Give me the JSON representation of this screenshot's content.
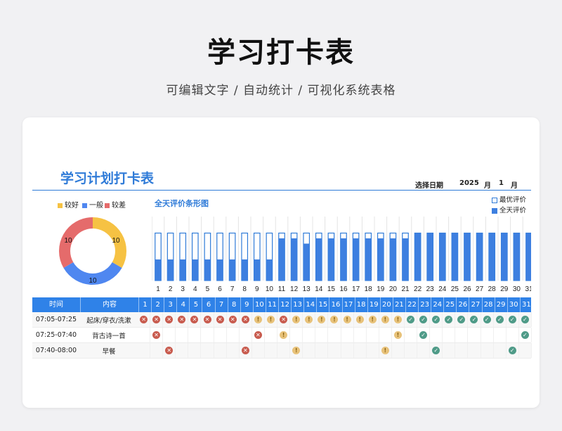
{
  "hero": {
    "title": "学习打卡表",
    "subtitle": "可编辑文字 / 自动统计 / 可视化系统表格"
  },
  "sheet": {
    "title": "学习计划打卡表",
    "date_label": "选择日期",
    "year": "2025",
    "year_unit": "月",
    "month": "1",
    "month_unit": "月"
  },
  "summary_legend": [
    {
      "label": "较好",
      "color": "#f6c243"
    },
    {
      "label": "一般",
      "color": "#4f87f0"
    },
    {
      "label": "较差",
      "color": "#e56b6b"
    }
  ],
  "summary_counts": [
    10,
    10,
    10
  ],
  "chart_title": "全天评价条形图",
  "chart_legend": {
    "best": "最优评价",
    "all": "全天评价"
  },
  "table": {
    "header_time": "时间",
    "header_content": "内容",
    "rows": [
      {
        "time": "07:05-07:25",
        "content": "起床/穿衣/洗漱",
        "marks": [
          "bad",
          "bad",
          "bad",
          "bad",
          "bad",
          "bad",
          "bad",
          "bad",
          "bad",
          "ok",
          "ok",
          "bad",
          "ok",
          "ok",
          "ok",
          "ok",
          "ok",
          "ok",
          "ok",
          "ok",
          "ok",
          "good",
          "good",
          "good",
          "good",
          "good",
          "good",
          "good",
          "good",
          "good",
          "good"
        ]
      },
      {
        "time": "07:25-07:40",
        "content": "背古诗一首",
        "marks": [
          "",
          "bad",
          "",
          "",
          "",
          "",
          "",
          "",
          "",
          "bad",
          "",
          "ok",
          "",
          "",
          "",
          "",
          "",
          "",
          "",
          "",
          "ok",
          "",
          "good",
          "",
          "",
          "",
          "",
          "",
          "",
          "",
          "good"
        ]
      },
      {
        "time": "07:40-08:00",
        "content": "早餐",
        "marks": [
          "",
          "",
          "bad",
          "",
          "",
          "",
          "",
          "",
          "bad",
          "",
          "",
          "",
          "ok",
          "",
          "",
          "",
          "",
          "",
          "",
          "ok",
          "",
          "",
          "",
          "good",
          "",
          "",
          "",
          "",
          "",
          "good",
          ""
        ]
      }
    ]
  },
  "chart_data": {
    "type": "bar",
    "title": "全天评价条形图",
    "categories": [
      "1",
      "2",
      "3",
      "4",
      "5",
      "6",
      "7",
      "8",
      "9",
      "10",
      "11",
      "12",
      "13",
      "14",
      "15",
      "16",
      "17",
      "18",
      "19",
      "20",
      "21",
      "22",
      "23",
      "24",
      "25",
      "26",
      "27",
      "28",
      "29",
      "30",
      "31"
    ],
    "series": [
      {
        "name": "最优评价",
        "values": [
          9,
          9,
          9,
          9,
          9,
          9,
          9,
          9,
          9,
          9,
          9,
          9,
          9,
          9,
          9,
          9,
          9,
          9,
          9,
          9,
          9,
          9,
          9,
          9,
          9,
          9,
          9,
          9,
          9,
          9,
          9
        ]
      },
      {
        "name": "全天评价",
        "values": [
          4,
          4,
          4,
          4,
          4,
          4,
          4,
          4,
          4,
          4,
          8,
          8,
          7,
          8,
          8,
          8,
          8,
          8,
          8,
          8,
          8,
          9,
          9,
          9,
          9,
          9,
          9,
          9,
          9,
          9,
          9
        ]
      }
    ],
    "ylim": [
      0,
      10
    ],
    "grid": false
  }
}
